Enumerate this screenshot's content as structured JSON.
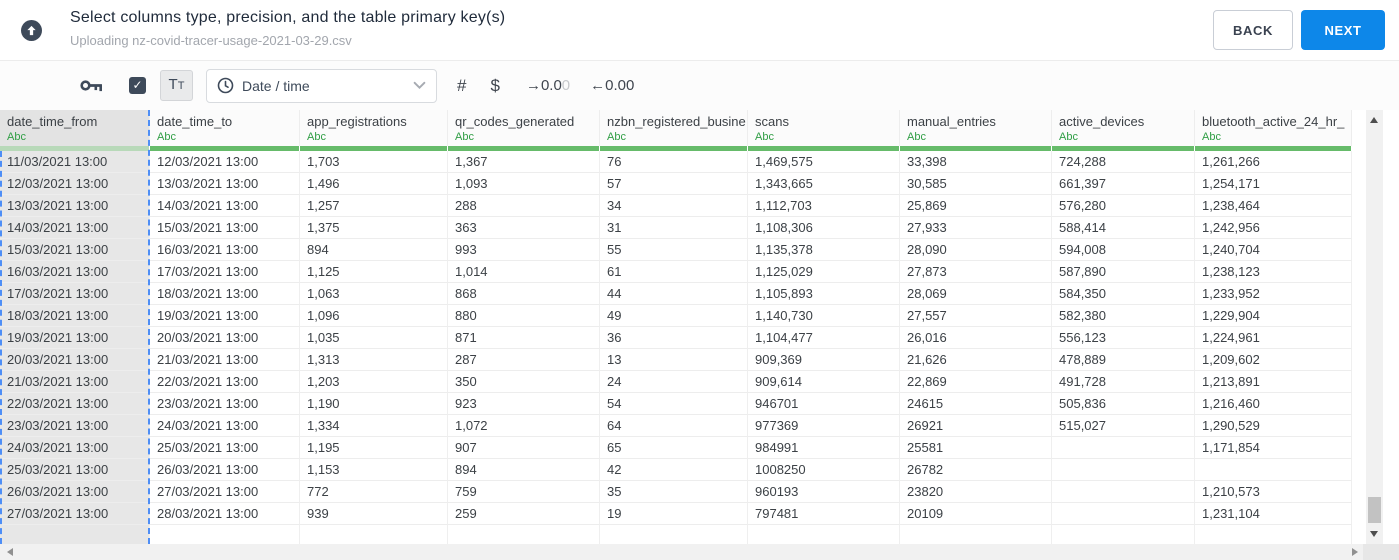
{
  "header": {
    "title": "Select columns type, precision, and the table primary key(s)",
    "subtitle": "Uploading nz-covid-tracer-usage-2021-03-29.csv",
    "back_label": "BACK",
    "next_label": "NEXT"
  },
  "toolbar": {
    "checkbox_checked": true,
    "text_format": {
      "primary": "T",
      "secondary": "T"
    },
    "type_select": {
      "value": "Date / time"
    },
    "number_label": "#",
    "currency_label": "$",
    "decimal_decrease": {
      "arrow": "→",
      "value_dark": "0.0",
      "value_light": "0"
    },
    "decimal_increase": {
      "arrow": "←",
      "value": "0.00"
    }
  },
  "icons": {
    "upload": "cloud-upload-arrow",
    "key": "primary-key",
    "checkbox_check": "✓",
    "clock": "clock",
    "chevron_down": "⌄",
    "scroll_up": "▲",
    "scroll_down": "▼",
    "scroll_left": "◄",
    "scroll_right": "►"
  },
  "colors": {
    "accent_blue": "#0d87e9",
    "type_bar_green": "#66bb6a",
    "type_label_green": "#2f9e44",
    "selection_dash_blue": "#4e8ef6",
    "dark_slate_icons": "#3e4a5a"
  },
  "table": {
    "type_label": "Abc",
    "selected_index": 0,
    "selected_column": "date_time_from",
    "columns": [
      "date_time_from",
      "date_time_to",
      "app_registrations",
      "qr_codes_generated",
      "nzbn_registered_busine",
      "scans",
      "manual_entries",
      "active_devices",
      "bluetooth_active_24_hr_"
    ],
    "rows": [
      [
        "11/03/2021 13:00",
        "12/03/2021 13:00",
        "1,703",
        "1,367",
        "76",
        "1,469,575",
        "33,398",
        "724,288",
        "1,261,266"
      ],
      [
        "12/03/2021 13:00",
        "13/03/2021 13:00",
        "1,496",
        "1,093",
        "57",
        "1,343,665",
        "30,585",
        "661,397",
        "1,254,171"
      ],
      [
        "13/03/2021 13:00",
        "14/03/2021 13:00",
        "1,257",
        "288",
        "34",
        "1,112,703",
        "25,869",
        "576,280",
        "1,238,464"
      ],
      [
        "14/03/2021 13:00",
        "15/03/2021 13:00",
        "1,375",
        "363",
        "31",
        "1,108,306",
        "27,933",
        "588,414",
        "1,242,956"
      ],
      [
        "15/03/2021 13:00",
        "16/03/2021 13:00",
        "894",
        "993",
        "55",
        "1,135,378",
        "28,090",
        "594,008",
        "1,240,704"
      ],
      [
        "16/03/2021 13:00",
        "17/03/2021 13:00",
        "1,125",
        "1,014",
        "61",
        "1,125,029",
        "27,873",
        "587,890",
        "1,238,123"
      ],
      [
        "17/03/2021 13:00",
        "18/03/2021 13:00",
        "1,063",
        "868",
        "44",
        "1,105,893",
        "28,069",
        "584,350",
        "1,233,952"
      ],
      [
        "18/03/2021 13:00",
        "19/03/2021 13:00",
        "1,096",
        "880",
        "49",
        "1,140,730",
        "27,557",
        "582,380",
        "1,229,904"
      ],
      [
        "19/03/2021 13:00",
        "20/03/2021 13:00",
        "1,035",
        "871",
        "36",
        "1,104,477",
        "26,016",
        "556,123",
        "1,224,961"
      ],
      [
        "20/03/2021 13:00",
        "21/03/2021 13:00",
        "1,313",
        "287",
        "13",
        "909,369",
        "21,626",
        "478,889",
        "1,209,602"
      ],
      [
        "21/03/2021 13:00",
        "22/03/2021 13:00",
        "1,203",
        "350",
        "24",
        "909,614",
        "22,869",
        "491,728",
        "1,213,891"
      ],
      [
        "22/03/2021 13:00",
        "23/03/2021 13:00",
        "1,190",
        "923",
        "54",
        "946701",
        "24615",
        "505,836",
        "1,216,460"
      ],
      [
        "23/03/2021 13:00",
        "24/03/2021 13:00",
        "1,334",
        "1,072",
        "64",
        "977369",
        "26921",
        "515,027",
        "1,290,529"
      ],
      [
        "24/03/2021 13:00",
        "25/03/2021 13:00",
        "1,195",
        "907",
        "65",
        "984991",
        "25581",
        "",
        "1,171,854"
      ],
      [
        "25/03/2021 13:00",
        "26/03/2021 13:00",
        "1,153",
        "894",
        "42",
        "1008250",
        "26782",
        "",
        ""
      ],
      [
        "26/03/2021 13:00",
        "27/03/2021 13:00",
        "772",
        "759",
        "35",
        "960193",
        "23820",
        "",
        "1,210,573"
      ],
      [
        "27/03/2021 13:00",
        "28/03/2021 13:00",
        "939",
        "259",
        "19",
        "797481",
        "20109",
        "",
        "1,231,104"
      ]
    ]
  }
}
